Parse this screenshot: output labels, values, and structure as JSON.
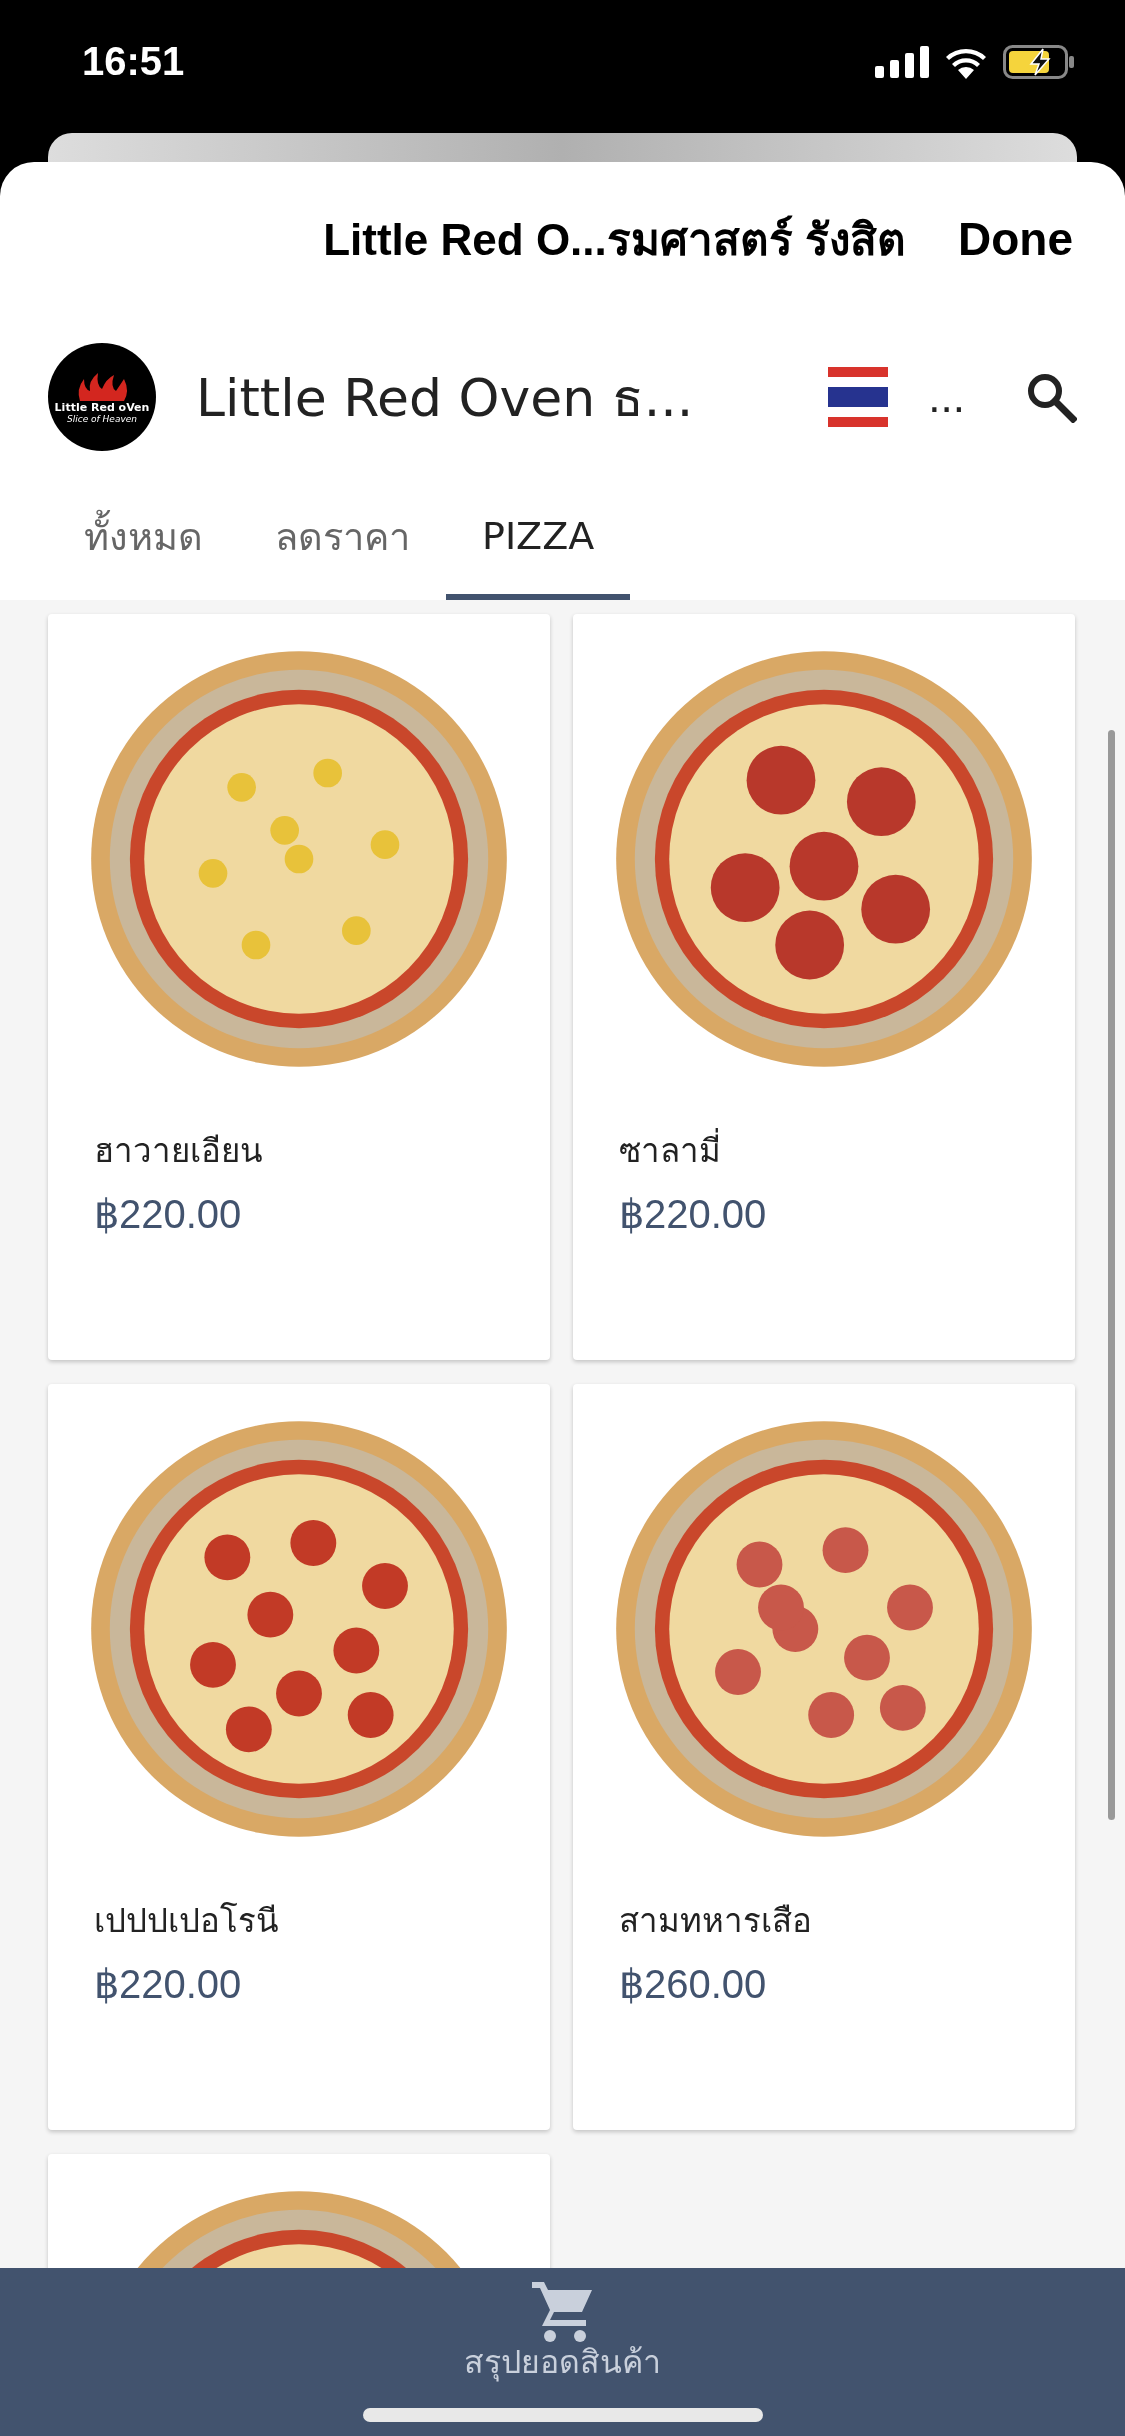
{
  "status_bar": {
    "time": "16:51"
  },
  "sheet": {
    "title": "Little Red O...รมศาสตร์ รังสิต",
    "done_label": "Done"
  },
  "header": {
    "logo_name": "Little Red oVen",
    "logo_tagline": "Slice of Heaven",
    "shop_name": "Little Red Oven ธ...",
    "more_label": "..."
  },
  "tabs": [
    {
      "label": "ทั้งหมด",
      "selected": false
    },
    {
      "label": "ลดราคา",
      "selected": false
    },
    {
      "label": "PIZZA",
      "selected": true
    }
  ],
  "products": [
    {
      "kind": "full",
      "name": "ฮาวายเอียน",
      "price": "฿220.00"
    },
    {
      "kind": "full",
      "name": "ซาลามี่",
      "price": "฿220.00"
    },
    {
      "kind": "full",
      "name": "เปปปเปอโรนี",
      "price": "฿220.00"
    },
    {
      "kind": "full",
      "name": "สามทหารเสือ",
      "price": "฿260.00"
    },
    {
      "kind": "partial"
    }
  ],
  "bottom_bar": {
    "label": "สรุปยอดสินค้า"
  }
}
